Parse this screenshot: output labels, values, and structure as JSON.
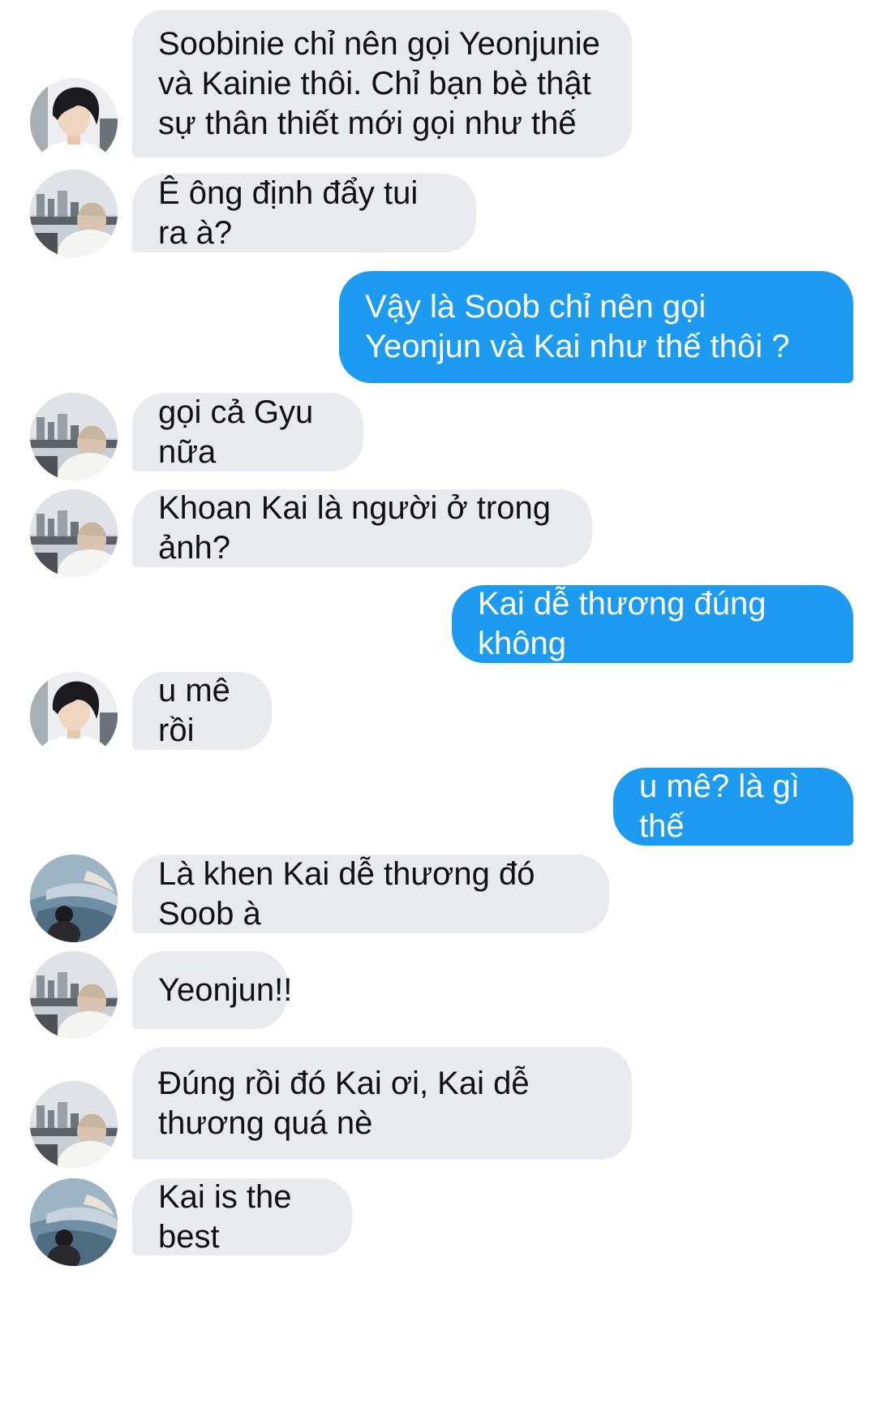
{
  "conversation": {
    "messages": [
      {
        "text": "Soobinie chỉ nên gọi Yeonjunie và Kainie thôi. Chỉ bạn bè thật sự thân thiết mới gọi như thế",
        "sender": "other",
        "avatar": "portrait-avatar-icon"
      },
      {
        "text": "Ê ông định đẩy tui ra à?",
        "sender": "other",
        "avatar": "city-photo-avatar-icon"
      },
      {
        "text": "Vậy là Soob chỉ nên gọi Yeonjun và Kai như thế thôi ?",
        "sender": "self"
      },
      {
        "text": "gọi cả Gyu nữa",
        "sender": "other",
        "avatar": "city-photo-avatar-icon"
      },
      {
        "text": "Khoan Kai là người ở trong ảnh?",
        "sender": "other",
        "avatar": "city-photo-avatar-icon"
      },
      {
        "text": "Kai dễ thương đúng không",
        "sender": "self"
      },
      {
        "text": "u mê rồi",
        "sender": "other",
        "avatar": "portrait-avatar-icon"
      },
      {
        "text": "u mê? là gì thế",
        "sender": "self"
      },
      {
        "text": "Là khen Kai dễ thương đó Soob à",
        "sender": "other",
        "avatar": "aquarium-avatar-icon"
      },
      {
        "text": "Yeonjun!!",
        "sender": "other",
        "avatar": "city-photo-avatar-icon"
      },
      {
        "text": "Đúng rồi đó Kai ơi, Kai dễ thương quá nè",
        "sender": "other",
        "avatar": "city-photo-avatar-icon"
      },
      {
        "text": "Kai is the best",
        "sender": "other",
        "avatar": "aquarium-avatar-icon"
      }
    ]
  },
  "colors": {
    "incoming_bubble": "#e9eaee",
    "outgoing_bubble": "#1d9bf0",
    "incoming_text": "#111111",
    "outgoing_text": "#ffffff"
  }
}
